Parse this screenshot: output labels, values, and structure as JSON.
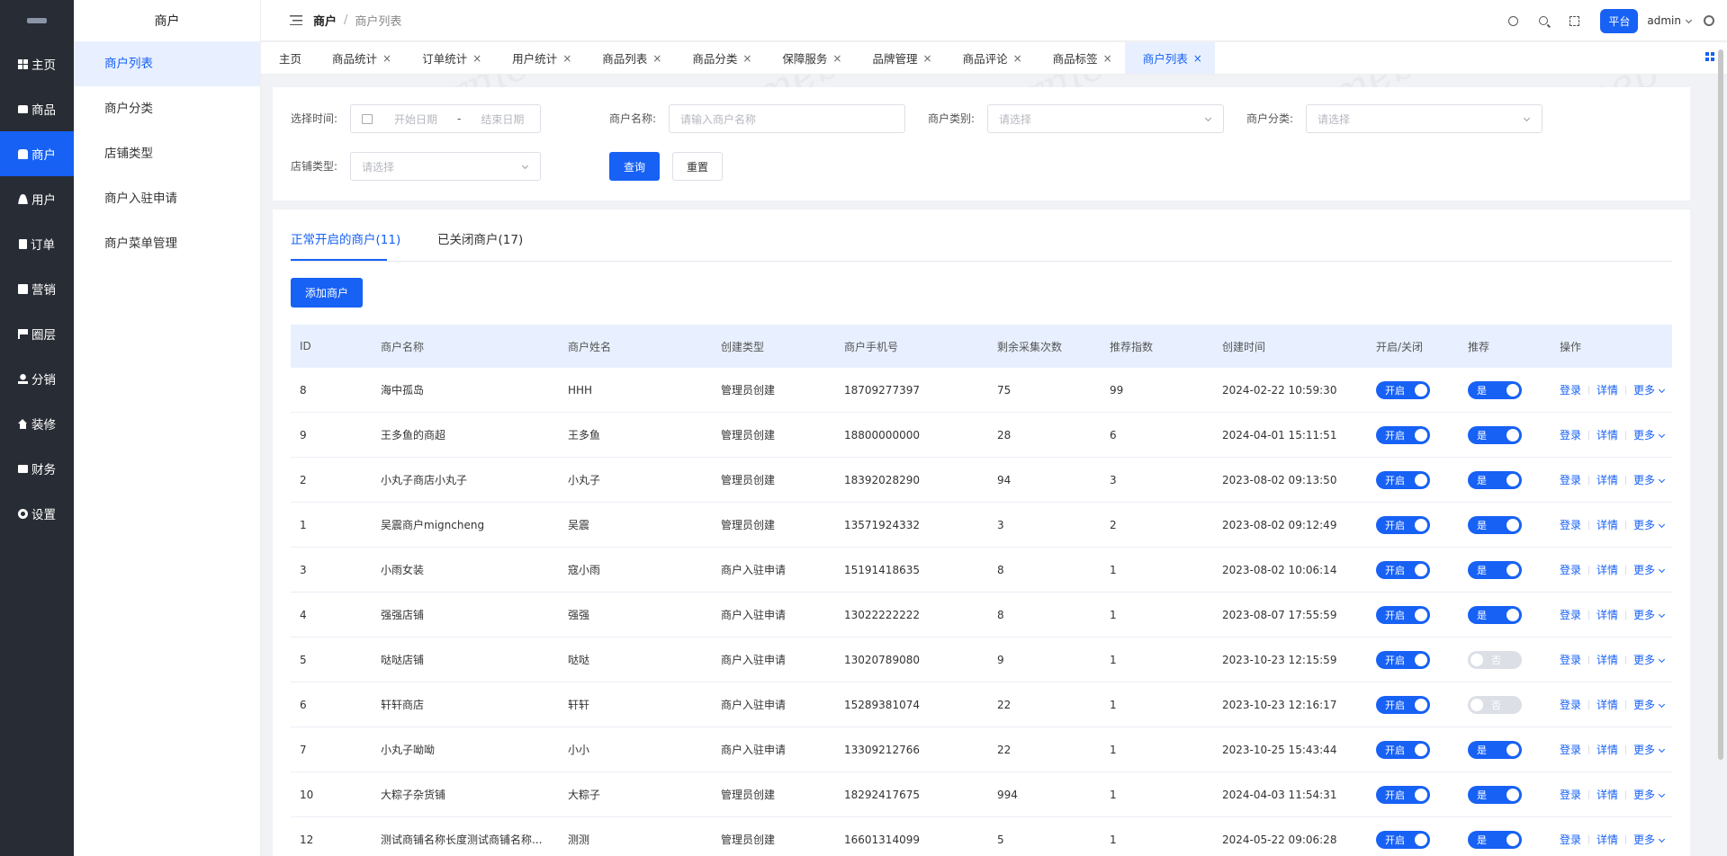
{
  "sidebar": {
    "items": [
      {
        "label": "主页",
        "icon": "grid-icon"
      },
      {
        "label": "商品",
        "icon": "bag-icon"
      },
      {
        "label": "商户",
        "icon": "store-icon"
      },
      {
        "label": "用户",
        "icon": "user-icon"
      },
      {
        "label": "订单",
        "icon": "order-icon"
      },
      {
        "label": "营销",
        "icon": "chart-icon"
      },
      {
        "label": "圈层",
        "icon": "flag-icon"
      },
      {
        "label": "分销",
        "icon": "share-icon"
      },
      {
        "label": "装修",
        "icon": "home-icon"
      },
      {
        "label": "财务",
        "icon": "wallet-icon"
      },
      {
        "label": "设置",
        "icon": "gear-icon"
      }
    ],
    "active_index": 2
  },
  "submenu": {
    "title": "商户",
    "items": [
      "商户列表",
      "商户分类",
      "店铺类型",
      "商户入驻申请",
      "商户菜单管理"
    ],
    "active_index": 0
  },
  "header": {
    "breadcrumb_root": "商户",
    "breadcrumb_sep": "/",
    "breadcrumb_current": "商户列表",
    "platform_label": "平台",
    "user": "admin"
  },
  "page_tabs": [
    "主页",
    "商品统计",
    "订单统计",
    "用户统计",
    "商品列表",
    "商品分类",
    "保障服务",
    "品牌管理",
    "商品评论",
    "商品标签",
    "商户列表"
  ],
  "page_tabs_active": 10,
  "filters": {
    "time_label": "选择时间:",
    "start_placeholder": "开始日期",
    "range_sep": "-",
    "end_placeholder": "结束日期",
    "name_label": "商户名称:",
    "name_placeholder": "请输入商户名称",
    "category_label": "商户类别:",
    "category_placeholder": "请选择",
    "class_label": "商户分类:",
    "class_placeholder": "请选择",
    "store_type_label": "店铺类型:",
    "store_type_placeholder": "请选择",
    "query_label": "查询",
    "reset_label": "重置"
  },
  "main": {
    "tab_open": "正常开启的商户(11)",
    "tab_closed": "已关闭商户(17)",
    "add_button": "添加商户"
  },
  "table": {
    "columns": [
      "ID",
      "商户名称",
      "商户姓名",
      "创建类型",
      "商户手机号",
      "剩余采集次数",
      "推荐指数",
      "创建时间",
      "开启/关闭",
      "推荐",
      "操作"
    ],
    "rows": [
      {
        "id": "8",
        "name": "海中孤岛",
        "person": "HHH",
        "type": "管理员创建",
        "phone": "18709277397",
        "left": "75",
        "rec": "99",
        "time": "2024-02-22 10:59:30",
        "open": "开启",
        "recommend": "是",
        "recommend_on": true
      },
      {
        "id": "9",
        "name": "王多鱼的商超",
        "person": "王多鱼",
        "type": "管理员创建",
        "phone": "18800000000",
        "left": "28",
        "rec": "6",
        "time": "2024-04-01 15:11:51",
        "open": "开启",
        "recommend": "是",
        "recommend_on": true
      },
      {
        "id": "2",
        "name": "小丸子商店小丸子",
        "person": "小丸子",
        "type": "管理员创建",
        "phone": "18392028290",
        "left": "94",
        "rec": "3",
        "time": "2023-08-02 09:13:50",
        "open": "开启",
        "recommend": "是",
        "recommend_on": true
      },
      {
        "id": "1",
        "name": "吴震商户migncheng",
        "person": "吴震",
        "type": "管理员创建",
        "phone": "13571924332",
        "left": "3",
        "rec": "2",
        "time": "2023-08-02 09:12:49",
        "open": "开启",
        "recommend": "是",
        "recommend_on": true
      },
      {
        "id": "3",
        "name": "小雨女装",
        "person": "寇小雨",
        "type": "商户入驻申请",
        "phone": "15191418635",
        "left": "8",
        "rec": "1",
        "time": "2023-08-02 10:06:14",
        "open": "开启",
        "recommend": "是",
        "recommend_on": true
      },
      {
        "id": "4",
        "name": "强强店铺",
        "person": "强强",
        "type": "商户入驻申请",
        "phone": "13022222222",
        "left": "8",
        "rec": "1",
        "time": "2023-08-07 17:55:59",
        "open": "开启",
        "recommend": "是",
        "recommend_on": true
      },
      {
        "id": "5",
        "name": "哒哒店铺",
        "person": "哒哒",
        "type": "商户入驻申请",
        "phone": "13020789080",
        "left": "9",
        "rec": "1",
        "time": "2023-10-23 12:15:59",
        "open": "开启",
        "recommend": "否",
        "recommend_on": false
      },
      {
        "id": "6",
        "name": "轩轩商店",
        "person": "轩轩",
        "type": "商户入驻申请",
        "phone": "15289381074",
        "left": "22",
        "rec": "1",
        "time": "2023-10-23 12:16:17",
        "open": "开启",
        "recommend": "否",
        "recommend_on": false
      },
      {
        "id": "7",
        "name": "小丸子呦呦",
        "person": "小小",
        "type": "商户入驻申请",
        "phone": "13309212766",
        "left": "22",
        "rec": "1",
        "time": "2023-10-25 15:43:44",
        "open": "开启",
        "recommend": "是",
        "recommend_on": true
      },
      {
        "id": "10",
        "name": "大粽子杂货铺",
        "person": "大粽子",
        "type": "管理员创建",
        "phone": "18292417675",
        "left": "994",
        "rec": "1",
        "time": "2024-04-03 11:54:31",
        "open": "开启",
        "recommend": "是",
        "recommend_on": true
      },
      {
        "id": "12",
        "name": "测试商铺名称长度测试商铺名称...",
        "person": "测测",
        "type": "管理员创建",
        "phone": "16601314099",
        "left": "5",
        "rec": "1",
        "time": "2024-05-22 09:06:28",
        "open": "开启",
        "recommend": "是",
        "recommend_on": true
      }
    ],
    "actions": {
      "login": "登录",
      "detail": "详情",
      "more": "更多"
    }
  },
  "colors": {
    "accent": "#1761f5",
    "sidebar_bg": "#282c34"
  },
  "watermark": "crmeb"
}
